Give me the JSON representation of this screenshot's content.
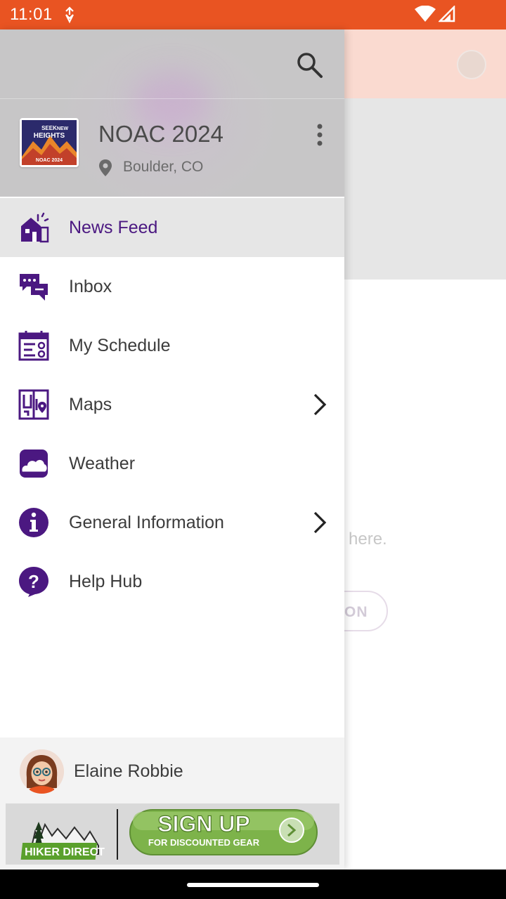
{
  "status_bar": {
    "time": "11:01",
    "icons": [
      "data-saver-icon",
      "wifi-icon",
      "signal-icon"
    ]
  },
  "background": {
    "empty_hint": "here.",
    "button_label": "ON"
  },
  "drawer": {
    "event": {
      "title": "NOAC 2024",
      "location": "Boulder, CO",
      "logo_lines": [
        "SEEK",
        "NEW",
        "HEIGHTS",
        "NOAC 2024"
      ]
    },
    "items": [
      {
        "label": "News Feed",
        "icon": "news-feed-icon",
        "active": true,
        "has_submenu": false
      },
      {
        "label": "Inbox",
        "icon": "inbox-icon",
        "active": false,
        "has_submenu": false
      },
      {
        "label": "My Schedule",
        "icon": "schedule-icon",
        "active": false,
        "has_submenu": false
      },
      {
        "label": "Maps",
        "icon": "map-icon",
        "active": false,
        "has_submenu": true
      },
      {
        "label": "Weather",
        "icon": "weather-icon",
        "active": false,
        "has_submenu": false
      },
      {
        "label": "General Information",
        "icon": "info-icon",
        "active": false,
        "has_submenu": true
      },
      {
        "label": "Help Hub",
        "icon": "help-icon",
        "active": false,
        "has_submenu": false
      }
    ],
    "user": {
      "name": "Elaine Robbie"
    },
    "ad": {
      "brand_line1": "HIKER DIRECT",
      "cta": "SIGN UP",
      "cta_sub": "FOR DISCOUNTED GEAR"
    }
  },
  "colors": {
    "status_bar": "#E95422",
    "accent_purple": "#4B1881",
    "header_pink": "#FADAD0",
    "ad_green": "#7DB34A"
  }
}
